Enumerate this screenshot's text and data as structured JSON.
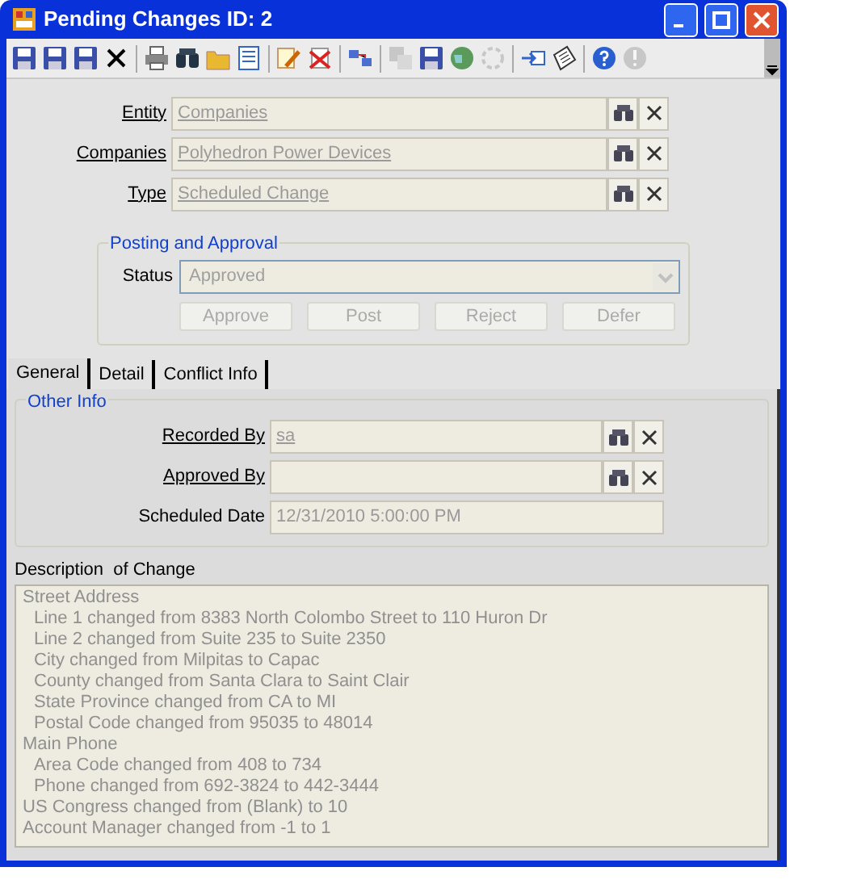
{
  "window": {
    "title": "Pending Changes ID: 2"
  },
  "toolbar": [
    {
      "kind": "save",
      "disabled": false
    },
    {
      "kind": "save",
      "disabled": false
    },
    {
      "kind": "save",
      "disabled": false
    },
    {
      "kind": "close",
      "disabled": false
    },
    {
      "kind": "sep"
    },
    {
      "kind": "print",
      "disabled": false
    },
    {
      "kind": "find",
      "disabled": false
    },
    {
      "kind": "folder",
      "disabled": false
    },
    {
      "kind": "list",
      "disabled": false
    },
    {
      "kind": "sep"
    },
    {
      "kind": "edit",
      "disabled": false
    },
    {
      "kind": "erase",
      "disabled": false
    },
    {
      "kind": "sep"
    },
    {
      "kind": "link",
      "disabled": false
    },
    {
      "kind": "sep"
    },
    {
      "kind": "copy",
      "disabled": true
    },
    {
      "kind": "save",
      "disabled": false
    },
    {
      "kind": "globe",
      "disabled": false
    },
    {
      "kind": "refresh",
      "disabled": true
    },
    {
      "kind": "sep"
    },
    {
      "kind": "arrow",
      "disabled": false
    },
    {
      "kind": "note",
      "disabled": false
    },
    {
      "kind": "sep"
    },
    {
      "kind": "help",
      "disabled": false
    },
    {
      "kind": "info",
      "disabled": true
    },
    {
      "kind": "more",
      "disabled": false
    }
  ],
  "fields": [
    {
      "label": "Entity",
      "value": "Companies"
    },
    {
      "label": "Companies",
      "value": "Polyhedron Power Devices"
    },
    {
      "label": "Type",
      "value": "Scheduled Change"
    }
  ],
  "posting": {
    "title": "Posting and Approval",
    "status_label": "Status",
    "status_value": "Approved",
    "buttons": [
      {
        "label": "Approve",
        "disabled": true
      },
      {
        "label": "Post",
        "disabled": true
      },
      {
        "label": "Reject",
        "disabled": true
      },
      {
        "label": "Defer",
        "disabled": true
      }
    ]
  },
  "tabs": [
    {
      "label": "General",
      "selected": true
    },
    {
      "label": "Detail",
      "selected": false
    },
    {
      "label": "Conflict Info",
      "selected": false
    }
  ],
  "other_info": {
    "title": "Other Info",
    "fields": [
      {
        "kind": "lookup",
        "label": "Recorded By",
        "value": "sa"
      },
      {
        "kind": "lookup",
        "label": "Approved By"
      },
      {
        "kind": "date",
        "label": "Scheduled Date",
        "value": "12/31/2010 5:00:00 PM"
      }
    ]
  },
  "description": {
    "label": "Description  of Change",
    "lines": [
      {
        "text": "Street Address",
        "children": [
          {
            "text": "Line 1 changed from 8383 North Colombo Street to 110 Huron Dr"
          },
          {
            "text": "Line 2 changed from Suite 235 to Suite 2350"
          },
          {
            "text": "City changed from Milpitas to Capac"
          },
          {
            "text": "County changed from Santa Clara to Saint Clair"
          },
          {
            "text": "State Province changed from CA to MI"
          },
          {
            "text": "Postal Code changed from 95035 to 48014"
          }
        ]
      },
      {
        "text": "Main Phone",
        "children": [
          {
            "text": "Area Code changed from 408 to 734"
          },
          {
            "text": "Phone changed from 692-3824 to 442-3444"
          }
        ]
      },
      {
        "text": "US Congress changed from (Blank) to 10"
      },
      {
        "text": "Account Manager changed from -1 to 1"
      }
    ]
  }
}
